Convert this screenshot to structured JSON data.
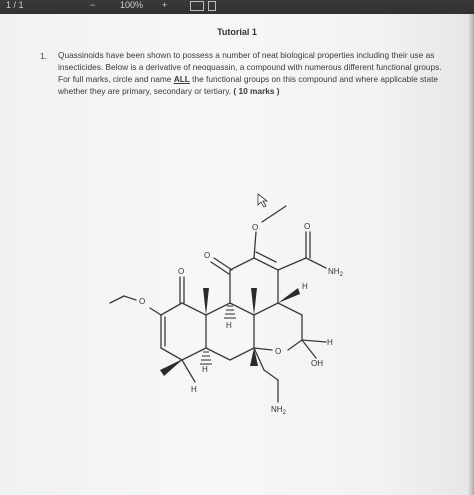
{
  "toolbar": {
    "left_text": "1 / 1",
    "zoom": "100%",
    "zoom_in_symbol": "+",
    "zoom_out_symbol": "−"
  },
  "document": {
    "title": "Tutorial 1",
    "question": {
      "number": "1.",
      "text_before_all": "Quassinoids have been shown to possess a number of neat biological properties including their use as insecticides. Below is a derivative of neoquassin, a compound with numerous different functional groups. For full marks, circle and name ",
      "all_emphasis": "ALL",
      "text_after_all": " the functional groups on this compound and where applicable state whether they are primary, secondary or tertiary.",
      "marks": "( 10 marks )"
    }
  },
  "molecule": {
    "labels": {
      "o_methoxy_top": "O",
      "o_carbonyl_top": "O",
      "o_ketone_left": "O",
      "o_ketone_mid": "O",
      "nh2_amide": "NH",
      "nh2_amide_sub": "2",
      "h_top_right": "H",
      "h_center": "H",
      "h_bottom": "H",
      "h_right": "H",
      "o_ring": "O",
      "oh": "OH",
      "nh2_bottom": "NH",
      "nh2_bottom_sub": "2",
      "o_methoxy_left": "O"
    }
  }
}
